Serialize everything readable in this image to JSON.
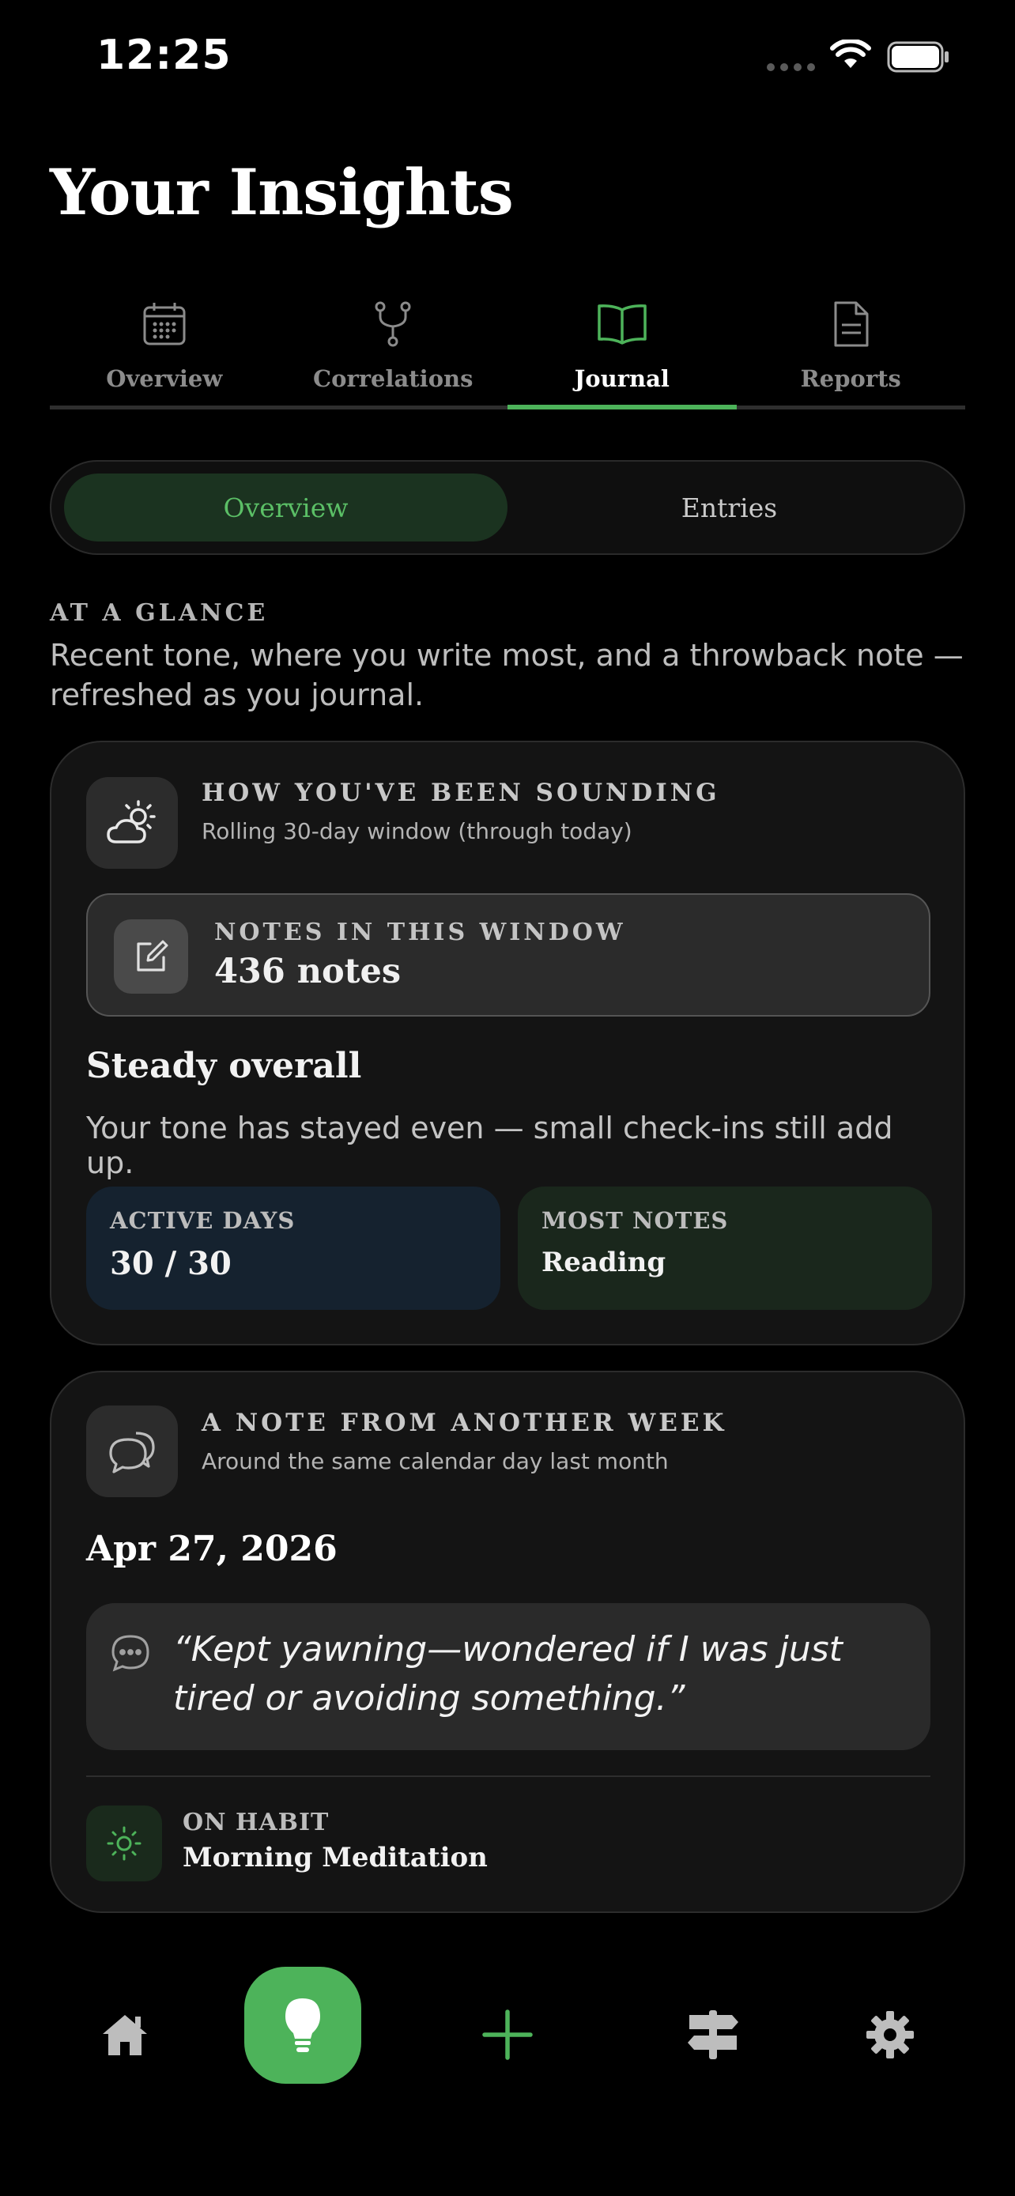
{
  "status_bar": {
    "time": "12:25"
  },
  "page": {
    "title": "Your Insights"
  },
  "tabs": [
    {
      "label": "Overview",
      "icon": "calendar-icon",
      "active": false
    },
    {
      "label": "Correlations",
      "icon": "branch-icon",
      "active": false
    },
    {
      "label": "Journal",
      "icon": "book-icon",
      "active": true
    },
    {
      "label": "Reports",
      "icon": "document-icon",
      "active": false
    }
  ],
  "segmented": {
    "options": [
      "Overview",
      "Entries"
    ],
    "selected": "Overview"
  },
  "glance": {
    "heading": "AT A GLANCE",
    "description": "Recent tone, where you write most, and a throwback note — refreshed as you journal."
  },
  "sounding_card": {
    "label": "HOW YOU'VE BEEN SOUNDING",
    "sub": "Rolling 30-day window (through today)",
    "notes_label": "NOTES IN THIS WINDOW",
    "notes_count": "436 notes",
    "headline": "Steady overall",
    "body": "Your tone has stayed even — small check-ins still add up.",
    "stats": [
      {
        "label": "ACTIVE DAYS",
        "value": "30 / 30"
      },
      {
        "label": "MOST NOTES",
        "value": "Reading"
      }
    ]
  },
  "throwback_card": {
    "label": "A NOTE FROM ANOTHER WEEK",
    "sub": "Around the same calendar day last month",
    "date": "Apr 27, 2026",
    "quote": "“Kept yawning—wondered if I was just tired or avoiding something.”",
    "habit_label": "ON HABIT",
    "habit_name": "Morning Meditation"
  },
  "colors": {
    "accent": "#4db35a",
    "background": "#000000",
    "card": "#141414"
  }
}
